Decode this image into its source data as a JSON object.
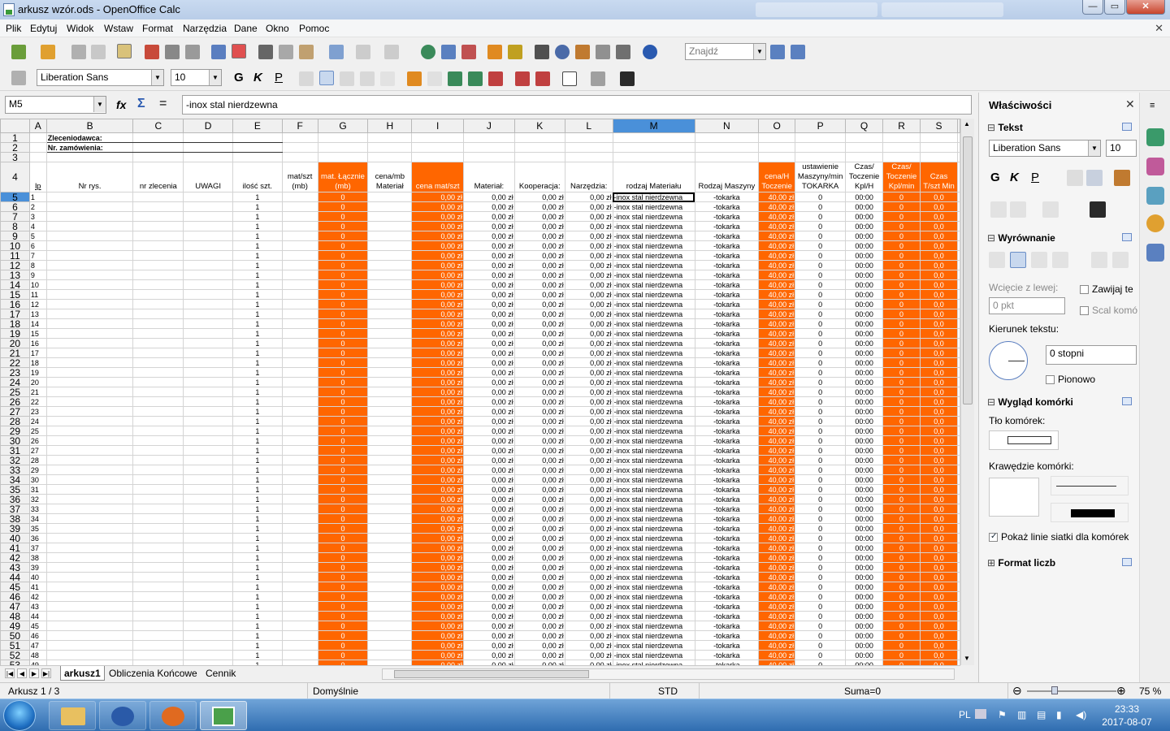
{
  "window": {
    "title": "arkusz wzór.ods - OpenOffice Calc",
    "controls": {
      "minimize": "—",
      "maximize": "▭",
      "close": "✕"
    }
  },
  "menu": [
    "Plik",
    "Edytuj",
    "Widok",
    "Wstaw",
    "Format",
    "Narzędzia",
    "Dane",
    "Okno",
    "Pomoc"
  ],
  "menu_close": "✕",
  "toolbar": {
    "find_placeholder": "Znajdź",
    "font_name": "Liberation Sans",
    "font_size": "10",
    "bold": "G",
    "italic": "K",
    "underline": "P"
  },
  "formula": {
    "cell_ref": "M5",
    "fx": "fx",
    "sum": "Σ",
    "eq": "=",
    "content": "-inox stal nierdzewna"
  },
  "sheet": {
    "columns": [
      "A",
      "B",
      "C",
      "D",
      "E",
      "F",
      "G",
      "H",
      "I",
      "J",
      "K",
      "L",
      "M",
      "N",
      "O",
      "P",
      "Q",
      "R",
      "S"
    ],
    "selected_col": "M",
    "row1_label": "Zleceniodawca:",
    "row2_label": "Nr. zamówienia:",
    "headers": {
      "A": "lp",
      "B": "Nr rys.",
      "C": "nr zlecenia",
      "D": "UWAGI",
      "E": "ilość szt.",
      "F": "mat/szt (mb)",
      "G": "mat. Łącznie (mb)",
      "H": "cena/mb Materiał",
      "I": "cena mat/szt",
      "J": "Materiał:",
      "K": "Kooperacja:",
      "L": "Narzędzia:",
      "M": "rodzaj Materiału",
      "N": "Rodzaj Maszyny",
      "O": "cena/H Toczenie",
      "P": "ustawienie Maszyny/min TOKARKA",
      "Q": "Czas/ Toczenie Kpl/H",
      "R": "Czas/ Toczenie Kpl/min",
      "S": "Czas T/szt Min"
    },
    "row_template": {
      "qty": "1",
      "zero": "0",
      "money": "0,00 zł",
      "material": "-inox stal nierdzewna",
      "machine": "-tokarka",
      "rate": "40,00 zł",
      "time": "00:00",
      "dec": "0,0"
    },
    "visible_data_rows": 49
  },
  "sheet_tabs": [
    "arkusz1",
    "Obliczenia Końcowe",
    "Cennik"
  ],
  "active_tab": "arkusz1",
  "sidebar": {
    "title": "Właściwości",
    "close": "✕",
    "text_section": "Tekst",
    "font": "Liberation Sans",
    "size": "10",
    "align_section": "Wyrównanie",
    "indent_label": "Wcięcie z lewej:",
    "indent_value": "0 pkt",
    "wrap_label": "Zawijaj te",
    "merge_label": "Scal komó",
    "direction_label": "Kierunek tekstu:",
    "degrees": "0 stopni",
    "vertical_label": "Pionowo",
    "cell_look_section": "Wygląd komórki",
    "bg_label": "Tło komórek:",
    "borders_label": "Krawędzie komórki:",
    "gridlines_label": "Pokaż linie siatki dla komórek",
    "number_format_section": "Format liczb"
  },
  "status": {
    "sheet": "Arkusz 1 / 3",
    "style": "Domyślnie",
    "mode": "STD",
    "sum": "Suma=0",
    "zoom": "75 %"
  },
  "taskbar": {
    "lang": "PL",
    "time": "23:33",
    "date": "2017-08-07"
  },
  "colors": {
    "orange": "#ff6600",
    "selection": "#4a90d9"
  }
}
